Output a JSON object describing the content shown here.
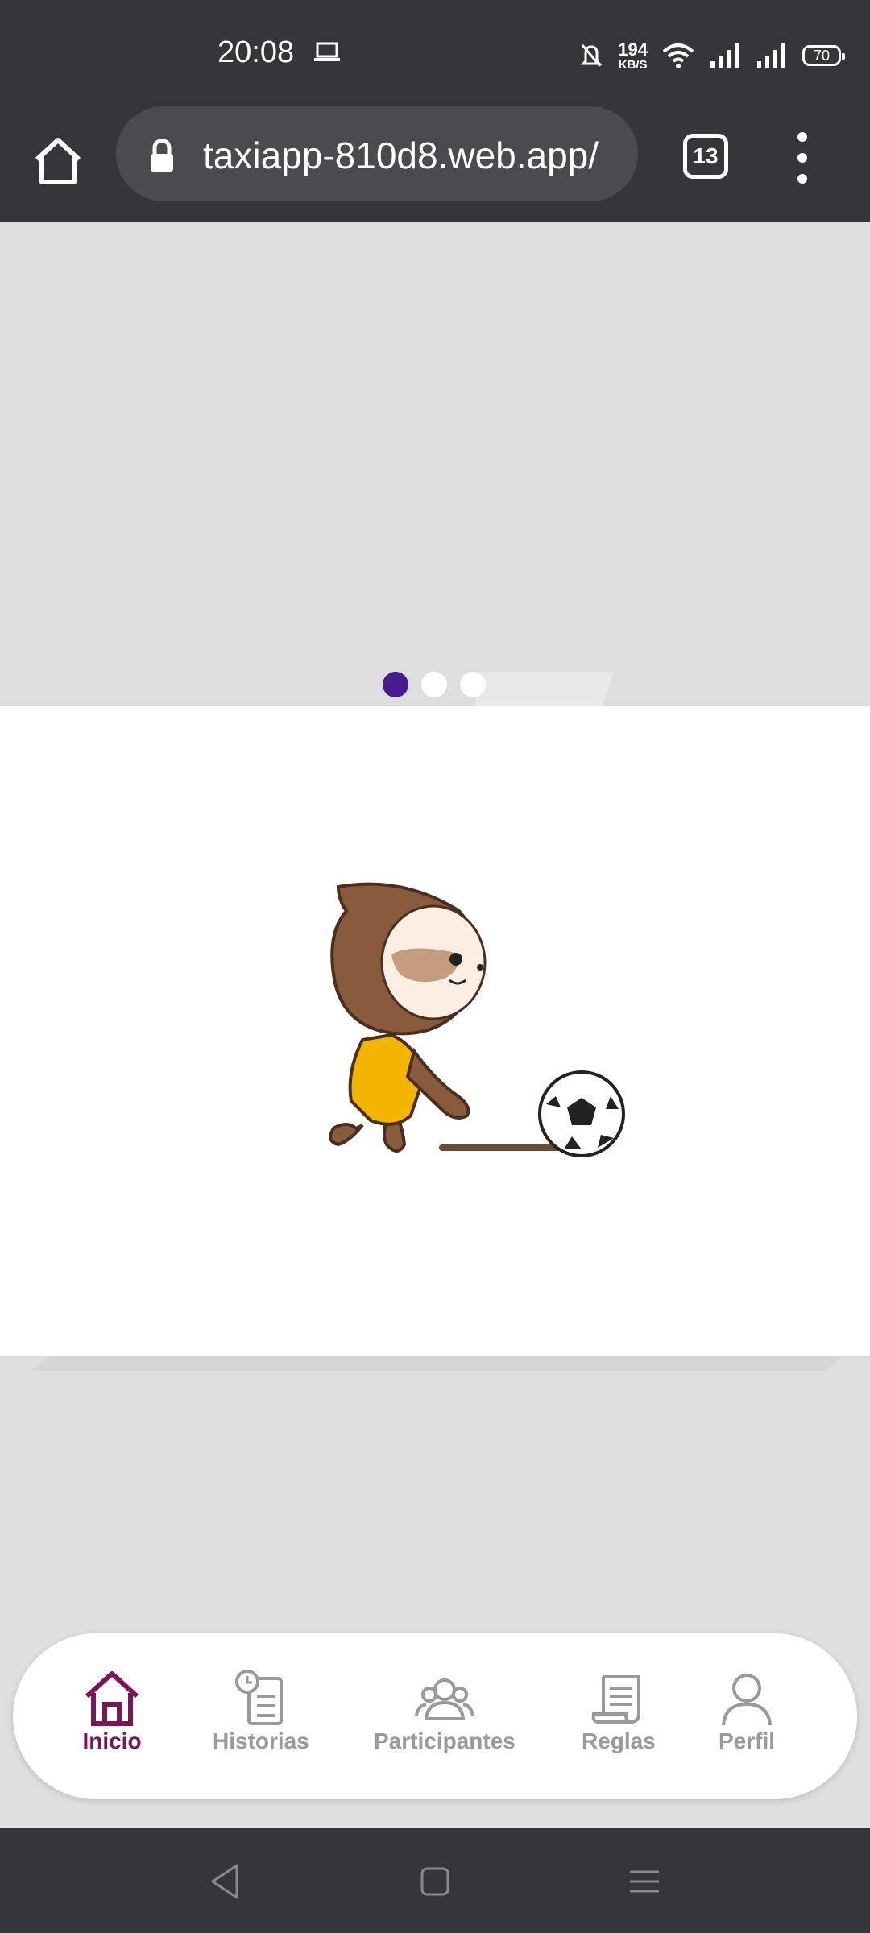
{
  "status_bar": {
    "time": "20:08",
    "net_speed_value": "194",
    "net_speed_unit": "KB/S",
    "battery": "70",
    "icons": [
      "laptop-icon",
      "bell-off-icon",
      "wifi-icon",
      "signal-icon",
      "signal-icon",
      "battery-icon"
    ]
  },
  "browser": {
    "url": "taxiapp-810d8.web.app/",
    "tab_count": "13"
  },
  "carousel": {
    "slides_total": 3,
    "active_index": 0
  },
  "bottom_nav": {
    "items": [
      {
        "label": "Inicio",
        "icon": "home-icon",
        "active": true
      },
      {
        "label": "Historias",
        "icon": "history-icon",
        "active": false
      },
      {
        "label": "Participantes",
        "icon": "participants-icon",
        "active": false
      },
      {
        "label": "Reglas",
        "icon": "rules-icon",
        "active": false
      },
      {
        "label": "Perfil",
        "icon": "profile-icon",
        "active": false
      }
    ]
  },
  "colors": {
    "accent": "#7a1558",
    "dot_active": "#4a1a8f",
    "chrome_bg": "#35363a",
    "page_bg": "#dedede"
  }
}
